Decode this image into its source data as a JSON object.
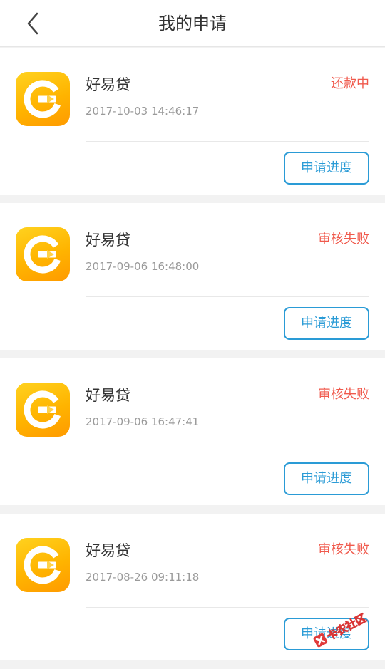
{
  "header": {
    "title": "我的申请"
  },
  "applications": [
    {
      "app_name": "好易贷",
      "time": "2017-10-03 14:46:17",
      "status": "还款中",
      "button_label": "申请进度"
    },
    {
      "app_name": "好易贷",
      "time": "2017-09-06 16:48:00",
      "status": "审核失败",
      "button_label": "申请进度"
    },
    {
      "app_name": "好易贷",
      "time": "2017-09-06 16:47:41",
      "status": "审核失败",
      "button_label": "申请进度"
    },
    {
      "app_name": "好易贷",
      "time": "2017-08-26 09:11:18",
      "status": "审核失败",
      "button_label": "申请进度"
    }
  ],
  "watermark": {
    "text": "卡农社区"
  },
  "colors": {
    "status_red": "#f05a4d",
    "button_blue": "#2a9bd6",
    "icon_orange": "#ffb400"
  }
}
